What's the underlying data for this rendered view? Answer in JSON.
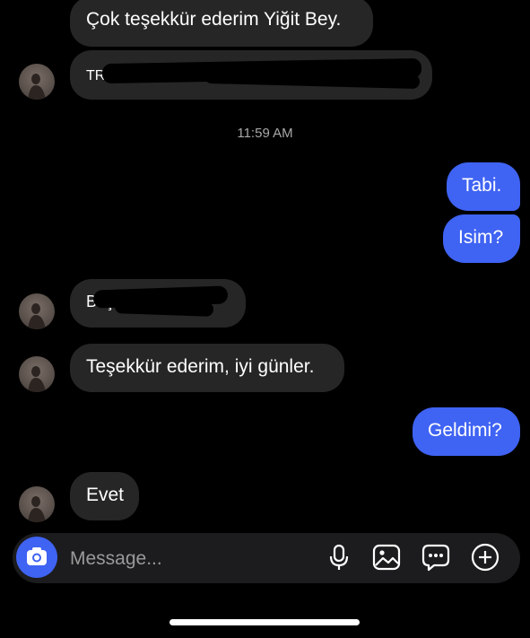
{
  "messages": [
    {
      "side": "in",
      "text": "Çok teşekkür ederim Yiğit Bey."
    },
    {
      "side": "in",
      "text": "TRAY",
      "redacted": true
    },
    {
      "side": "out",
      "text": "Tabi."
    },
    {
      "side": "out",
      "text": "Isim?"
    },
    {
      "side": "in",
      "text": "Büş",
      "redacted": true
    },
    {
      "side": "in",
      "text": "Teşekkür ederim, iyi günler."
    },
    {
      "side": "out",
      "text": "Geldimi?"
    },
    {
      "side": "in",
      "text": "Evet"
    }
  ],
  "timestamp": "11:59 AM",
  "composer": {
    "placeholder": "Message...",
    "icons": [
      "camera-icon",
      "microphone-icon",
      "gallery-icon",
      "sticker-icon",
      "plus-icon"
    ]
  },
  "colors": {
    "background": "#000000",
    "incoming_bubble": "#262626",
    "outgoing_bubble": "#3f63f3",
    "accent": "#3f63f3"
  }
}
